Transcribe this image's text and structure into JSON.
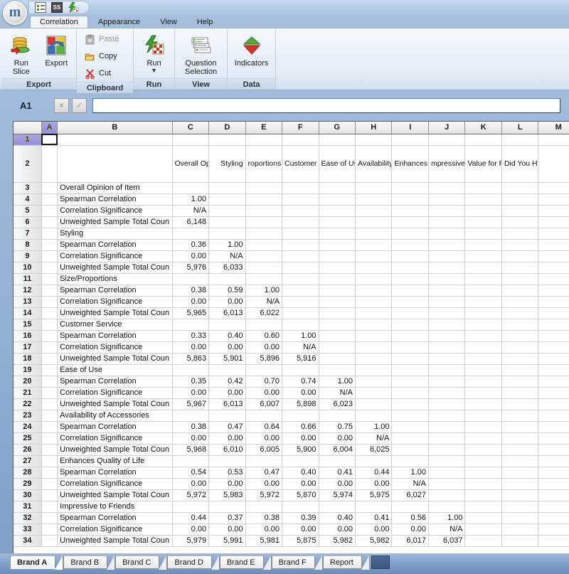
{
  "app": {
    "logo_letter": "m"
  },
  "quick_access": {
    "items": [
      {
        "name": "question-list-icon",
        "title": "Question List"
      },
      {
        "name": "spss-icon",
        "title": "SPSS",
        "label": "SS"
      },
      {
        "name": "run-lightning-icon",
        "title": "Run"
      }
    ]
  },
  "ribbon": {
    "tabs": [
      {
        "label": "Correlation",
        "active": true
      },
      {
        "label": "Appearance",
        "active": false
      },
      {
        "label": "View",
        "active": false
      },
      {
        "label": "Help",
        "active": false
      }
    ],
    "groups": [
      {
        "title": "Export",
        "buttons": [
          {
            "label": "Run\nSlice",
            "label_line1": "Run",
            "label_line2": "Slice",
            "icon": "database-run-icon",
            "enabled": true
          },
          {
            "label": "Export",
            "label_line1": "Export",
            "label_line2": "",
            "icon": "export-icon",
            "enabled": true
          }
        ]
      },
      {
        "title": "Clipboard",
        "small_buttons": [
          {
            "label": "Paste",
            "icon": "paste-icon",
            "enabled": false
          },
          {
            "label": "Copy",
            "icon": "copy-icon",
            "enabled": true
          },
          {
            "label": "Cut",
            "icon": "cut-icon",
            "enabled": true
          }
        ]
      },
      {
        "title": "Run",
        "buttons": [
          {
            "label_line1": "Run",
            "label_line2": "",
            "icon": "run-lightning-grid-icon",
            "enabled": true,
            "has_caret": true
          }
        ]
      },
      {
        "title": "View",
        "buttons": [
          {
            "label_line1": "Question",
            "label_line2": "Selection",
            "icon": "question-selection-icon",
            "enabled": true
          }
        ]
      },
      {
        "title": "Data",
        "buttons": [
          {
            "label_line1": "Indicators",
            "label_line2": "",
            "icon": "indicators-arrows-icon",
            "enabled": true
          }
        ]
      }
    ]
  },
  "formula_bar": {
    "cell_reference": "A1",
    "cancel_label": "×",
    "confirm_label": "✓",
    "value": "",
    "placeholder": ""
  },
  "sheet": {
    "selected_cell": "A1",
    "columns": [
      {
        "letter": "A",
        "width": 22
      },
      {
        "letter": "B",
        "width": 160
      },
      {
        "letter": "C",
        "width": 52
      },
      {
        "letter": "D",
        "width": 52
      },
      {
        "letter": "E",
        "width": 52
      },
      {
        "letter": "F",
        "width": 52
      },
      {
        "letter": "G",
        "width": 52
      },
      {
        "letter": "H",
        "width": 52
      },
      {
        "letter": "I",
        "width": 52
      },
      {
        "letter": "J",
        "width": 52
      },
      {
        "letter": "K",
        "width": 52
      },
      {
        "letter": "L",
        "width": 52
      },
      {
        "letter": "M",
        "width": 52
      }
    ],
    "header_row_number": "2",
    "header_labels": {
      "C": "Overall Opinion of Item",
      "D": "Styling",
      "E": "roportions",
      "F": "Customer Service",
      "G": "Ease of Use",
      "H": "Availability of :cessories",
      "I": "Enhances Quality of Life",
      "J": "mpressive to Friends",
      "K": "Value for Price Paid",
      "L": "Did You Have Any Problems",
      "M": ""
    },
    "rows": [
      {
        "num": "1",
        "kind": "blank",
        "label": "",
        "values": [
          "",
          "",
          "",
          "",
          "",
          "",
          "",
          "",
          "",
          ""
        ]
      },
      {
        "num": "2",
        "kind": "header",
        "label": "",
        "values": []
      },
      {
        "num": "3",
        "kind": "group",
        "label": "Overall Opinion of Item",
        "values": [
          "",
          "",
          "",
          "",
          "",
          "",
          "",
          "",
          "",
          ""
        ]
      },
      {
        "num": "4",
        "kind": "item",
        "label": "Spearman Correlation",
        "values": [
          "1.00",
          "",
          "",
          "",
          "",
          "",
          "",
          "",
          "",
          ""
        ]
      },
      {
        "num": "5",
        "kind": "item",
        "label": "Correlation Significance",
        "values": [
          "N/A",
          "",
          "",
          "",
          "",
          "",
          "",
          "",
          "",
          ""
        ]
      },
      {
        "num": "6",
        "kind": "item",
        "label": "Unweighted Sample Total Coun",
        "values": [
          "6,148",
          "",
          "",
          "",
          "",
          "",
          "",
          "",
          "",
          ""
        ]
      },
      {
        "num": "7",
        "kind": "group",
        "label": "Styling",
        "values": [
          "",
          "",
          "",
          "",
          "",
          "",
          "",
          "",
          "",
          ""
        ]
      },
      {
        "num": "8",
        "kind": "item",
        "label": "Spearman Correlation",
        "values": [
          "0.36",
          "1.00",
          "",
          "",
          "",
          "",
          "",
          "",
          "",
          ""
        ]
      },
      {
        "num": "9",
        "kind": "item",
        "label": "Correlation Significance",
        "values": [
          "0.00",
          "N/A",
          "",
          "",
          "",
          "",
          "",
          "",
          "",
          ""
        ]
      },
      {
        "num": "10",
        "kind": "item",
        "label": "Unweighted Sample Total Coun",
        "values": [
          "5,976",
          "6,033",
          "",
          "",
          "",
          "",
          "",
          "",
          "",
          ""
        ]
      },
      {
        "num": "11",
        "kind": "group",
        "label": "Size/Proportions",
        "values": [
          "",
          "",
          "",
          "",
          "",
          "",
          "",
          "",
          "",
          ""
        ]
      },
      {
        "num": "12",
        "kind": "item",
        "label": "Spearman Correlation",
        "values": [
          "0.38",
          "0.59",
          "1.00",
          "",
          "",
          "",
          "",
          "",
          "",
          ""
        ]
      },
      {
        "num": "13",
        "kind": "item",
        "label": "Correlation Significance",
        "values": [
          "0.00",
          "0.00",
          "N/A",
          "",
          "",
          "",
          "",
          "",
          "",
          ""
        ]
      },
      {
        "num": "14",
        "kind": "item",
        "label": "Unweighted Sample Total Coun",
        "values": [
          "5,965",
          "6,013",
          "6,022",
          "",
          "",
          "",
          "",
          "",
          "",
          ""
        ]
      },
      {
        "num": "15",
        "kind": "group",
        "label": "Customer Service",
        "values": [
          "",
          "",
          "",
          "",
          "",
          "",
          "",
          "",
          "",
          ""
        ]
      },
      {
        "num": "16",
        "kind": "item",
        "label": "Spearman Correlation",
        "values": [
          "0.33",
          "0.40",
          "0.60",
          "1.00",
          "",
          "",
          "",
          "",
          "",
          ""
        ]
      },
      {
        "num": "17",
        "kind": "item",
        "label": "Correlation Significance",
        "values": [
          "0.00",
          "0.00",
          "0.00",
          "N/A",
          "",
          "",
          "",
          "",
          "",
          ""
        ]
      },
      {
        "num": "18",
        "kind": "item",
        "label": "Unweighted Sample Total Coun",
        "values": [
          "5,863",
          "5,901",
          "5,896",
          "5,916",
          "",
          "",
          "",
          "",
          "",
          ""
        ]
      },
      {
        "num": "19",
        "kind": "group",
        "label": "Ease of Use",
        "values": [
          "",
          "",
          "",
          "",
          "",
          "",
          "",
          "",
          "",
          ""
        ]
      },
      {
        "num": "20",
        "kind": "item",
        "label": "Spearman Correlation",
        "values": [
          "0.35",
          "0.42",
          "0.70",
          "0.74",
          "1.00",
          "",
          "",
          "",
          "",
          ""
        ]
      },
      {
        "num": "21",
        "kind": "item",
        "label": "Correlation Significance",
        "values": [
          "0.00",
          "0.00",
          "0.00",
          "0.00",
          "N/A",
          "",
          "",
          "",
          "",
          ""
        ]
      },
      {
        "num": "22",
        "kind": "item",
        "label": "Unweighted Sample Total Coun",
        "values": [
          "5,967",
          "6,013",
          "6,007",
          "5,898",
          "6,023",
          "",
          "",
          "",
          "",
          ""
        ]
      },
      {
        "num": "23",
        "kind": "group",
        "label": "Availability of Accessories",
        "values": [
          "",
          "",
          "",
          "",
          "",
          "",
          "",
          "",
          "",
          ""
        ]
      },
      {
        "num": "24",
        "kind": "item",
        "label": "Spearman Correlation",
        "values": [
          "0.38",
          "0.47",
          "0.64",
          "0.66",
          "0.75",
          "1.00",
          "",
          "",
          "",
          ""
        ]
      },
      {
        "num": "25",
        "kind": "item",
        "label": "Correlation Significance",
        "values": [
          "0.00",
          "0.00",
          "0.00",
          "0.00",
          "0.00",
          "N/A",
          "",
          "",
          "",
          ""
        ]
      },
      {
        "num": "26",
        "kind": "item",
        "label": "Unweighted Sample Total Coun",
        "values": [
          "5,968",
          "6,010",
          "6,005",
          "5,900",
          "6,004",
          "6,025",
          "",
          "",
          "",
          ""
        ]
      },
      {
        "num": "27",
        "kind": "group",
        "label": "Enhances Quality of Life",
        "values": [
          "",
          "",
          "",
          "",
          "",
          "",
          "",
          "",
          "",
          ""
        ]
      },
      {
        "num": "28",
        "kind": "item",
        "label": "Spearman Correlation",
        "values": [
          "0.54",
          "0.53",
          "0.47",
          "0.40",
          "0.41",
          "0.44",
          "1.00",
          "",
          "",
          ""
        ]
      },
      {
        "num": "29",
        "kind": "item",
        "label": "Correlation Significance",
        "values": [
          "0.00",
          "0.00",
          "0.00",
          "0.00",
          "0.00",
          "0.00",
          "N/A",
          "",
          "",
          ""
        ]
      },
      {
        "num": "30",
        "kind": "item",
        "label": "Unweighted Sample Total Coun",
        "values": [
          "5,972",
          "5,983",
          "5,972",
          "5,870",
          "5,974",
          "5,975",
          "6,027",
          "",
          "",
          ""
        ]
      },
      {
        "num": "31",
        "kind": "group",
        "label": "Impressive to Friends",
        "values": [
          "",
          "",
          "",
          "",
          "",
          "",
          "",
          "",
          "",
          ""
        ]
      },
      {
        "num": "32",
        "kind": "item",
        "label": "Spearman Correlation",
        "values": [
          "0.44",
          "0.37",
          "0.38",
          "0.39",
          "0.40",
          "0.41",
          "0.56",
          "1.00",
          "",
          ""
        ]
      },
      {
        "num": "33",
        "kind": "item",
        "label": "Correlation Significance",
        "values": [
          "0.00",
          "0.00",
          "0.00",
          "0.00",
          "0.00",
          "0.00",
          "0.00",
          "N/A",
          "",
          ""
        ]
      },
      {
        "num": "34",
        "kind": "item",
        "label": "Unweighted Sample Total Coun",
        "values": [
          "5,979",
          "5,991",
          "5,981",
          "5,875",
          "5,982",
          "5,982",
          "6,017",
          "6,037",
          "",
          ""
        ]
      }
    ]
  },
  "sheet_tabs": [
    {
      "label": "Brand A",
      "active": true
    },
    {
      "label": "Brand B",
      "active": false
    },
    {
      "label": "Brand C",
      "active": false
    },
    {
      "label": "Brand D",
      "active": false
    },
    {
      "label": "Brand E",
      "active": false
    },
    {
      "label": "Brand F",
      "active": false
    },
    {
      "label": "Report",
      "active": false
    }
  ],
  "colors": {
    "window_blue": "#7E9DC8",
    "selection_lavender": "#9090D4",
    "ribbon_light": "#F4F8FC",
    "grid_line": "#D0D0D0"
  }
}
